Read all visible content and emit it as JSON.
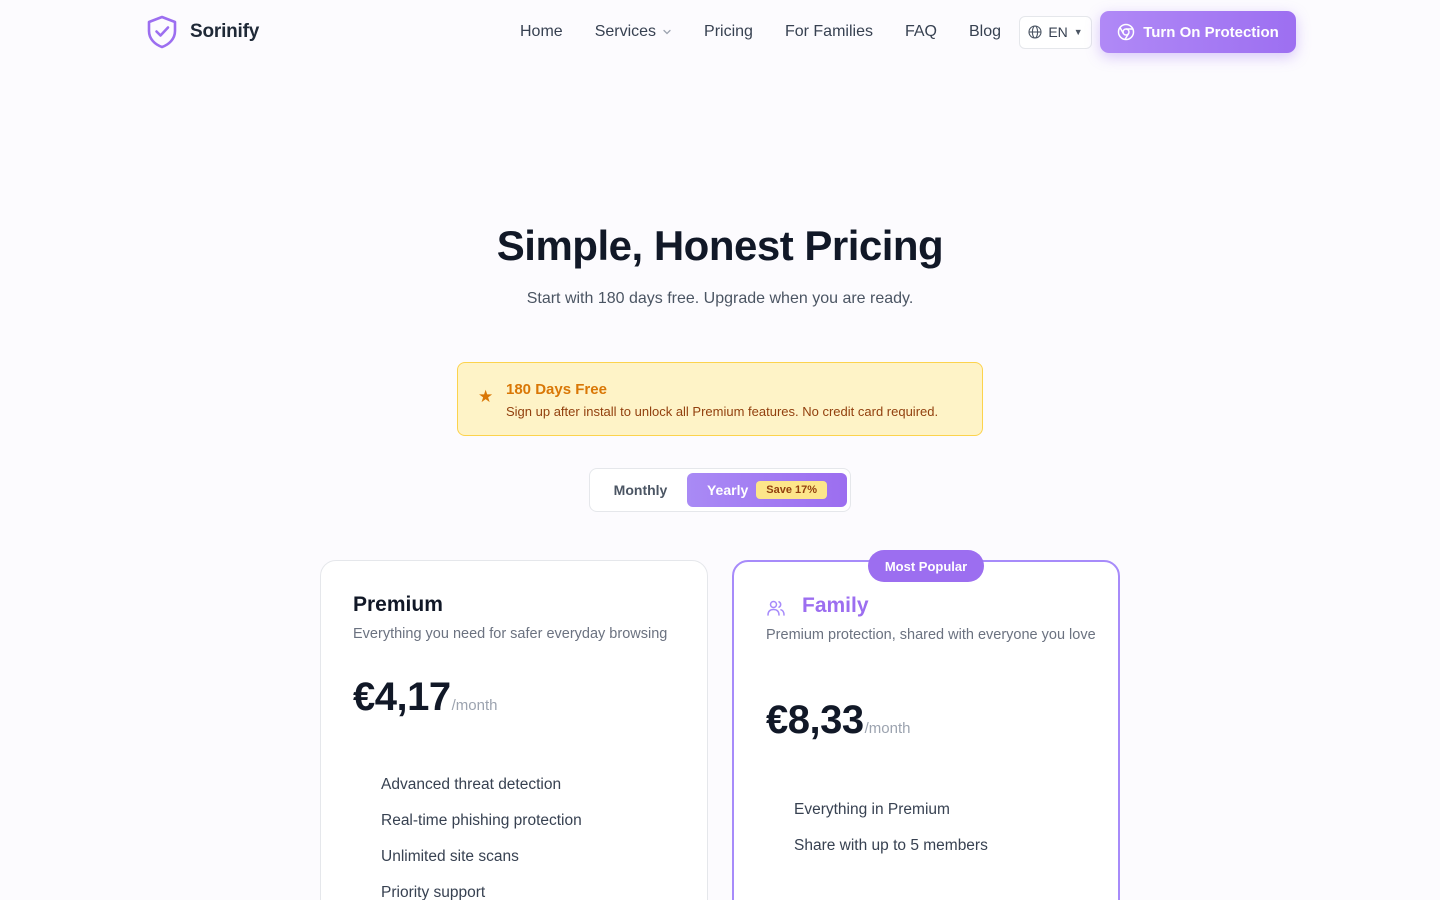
{
  "brand": {
    "name": "Sorinify",
    "logo_icon": "shield-check-icon",
    "accent": "#9c6ef0"
  },
  "nav": {
    "items": [
      {
        "label": "Home"
      },
      {
        "label": "Services",
        "has_dropdown": true
      },
      {
        "label": "Pricing"
      },
      {
        "label": "For Families"
      },
      {
        "label": "FAQ"
      },
      {
        "label": "Blog"
      }
    ],
    "language": {
      "label": "EN",
      "icon": "globe-icon"
    },
    "cta_label": "Turn On Protection",
    "cta_icon": "chrome-icon"
  },
  "hero": {
    "title": "Simple, Honest Pricing",
    "subtitle": "Start with 180 days free. Upgrade when you are ready."
  },
  "promo": {
    "icon": "star-icon",
    "title": "180 Days Free",
    "text": "Sign up after install to unlock all Premium features. No credit card required.",
    "bg_color": "#fef3c7"
  },
  "billing_toggle": {
    "monthly_label": "Monthly",
    "yearly_label": "Yearly",
    "save_badge": "Save 17%",
    "selected": "Yearly"
  },
  "plans": [
    {
      "name": "Premium",
      "description": "Everything you need for safer everyday browsing",
      "price": "€4,17",
      "period": "/month",
      "features": [
        "Advanced threat detection",
        "Real-time phishing protection",
        "Unlimited site scans",
        "Priority support"
      ]
    },
    {
      "name": "Family",
      "badge": "Most Popular",
      "icon": "users-icon",
      "description": "Premium protection, shared with everyone you love",
      "price": "€8,33",
      "period": "/month",
      "features": [
        "Everything in Premium",
        "Share with up to 5 members"
      ]
    }
  ]
}
